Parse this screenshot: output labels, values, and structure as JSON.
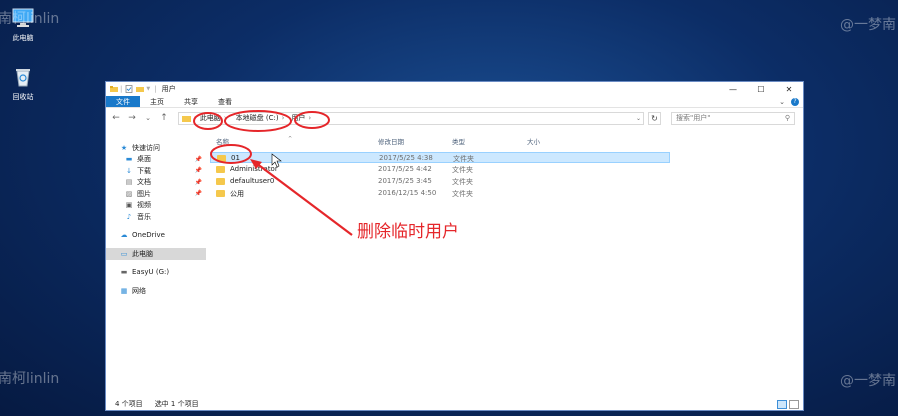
{
  "desktop": {
    "icons": [
      {
        "name": "this-pc-desktop-icon",
        "label": "此电脑"
      },
      {
        "name": "recycle-bin-desktop-icon",
        "label": "回收站"
      }
    ],
    "watermarks": [
      "南柯linlin",
      "@一梦南",
      "南柯linlin",
      "@一梦南"
    ]
  },
  "window": {
    "title": "用户",
    "qat_separator": "|",
    "qat_dropdown": "▼",
    "controls": {
      "minimize": "—",
      "maximize": "☐",
      "close": "✕"
    },
    "ribbon_tabs": [
      "文件",
      "主页",
      "共享",
      "查看"
    ],
    "ribbon_expand": "⌄",
    "help": "?",
    "nav": {
      "back": "←",
      "forward": "→",
      "recent": "⌄",
      "up": "↑"
    },
    "breadcrumb": [
      "此电脑",
      "本地磁盘 (C:)",
      "用户"
    ],
    "breadcrumb_sep": "›",
    "address_dropdown": "⌄",
    "refresh": "↻",
    "search": {
      "placeholder": "搜索\"用户\"",
      "icon": "⚲"
    }
  },
  "navpane": {
    "quick_access": {
      "label": "快速访问",
      "icon": "★"
    },
    "pinned": [
      {
        "label": "桌面",
        "icon": "▬"
      },
      {
        "label": "下载",
        "icon": "↓"
      },
      {
        "label": "文档",
        "icon": "▤"
      },
      {
        "label": "图片",
        "icon": "▨"
      }
    ],
    "pin_icon": "📌",
    "others": [
      {
        "label": "视频",
        "icon": "▣"
      },
      {
        "label": "音乐",
        "icon": "♪"
      }
    ],
    "onedrive": {
      "label": "OneDrive",
      "icon": "☁"
    },
    "this_pc": {
      "label": "此电脑",
      "icon": "▭"
    },
    "easyu": {
      "label": "EasyU (G:)",
      "icon": "▬"
    },
    "network": {
      "label": "网络",
      "icon": "▦"
    }
  },
  "columns": {
    "name": "名称",
    "date": "修改日期",
    "type": "类型",
    "size": "大小",
    "sort_caret": "^"
  },
  "files": [
    {
      "name": "01",
      "date": "2017/5/25 4:38",
      "type": "文件夹",
      "selected": true
    },
    {
      "name": "Administrator",
      "date": "2017/5/25 4:42",
      "type": "文件夹",
      "selected": false
    },
    {
      "name": "defaultuser0",
      "date": "2017/5/25 3:45",
      "type": "文件夹",
      "selected": false
    },
    {
      "name": "公用",
      "date": "2016/12/15 4:50",
      "type": "文件夹",
      "selected": false
    }
  ],
  "status": {
    "count": "4 个项目",
    "selected": "选中 1 个项目"
  },
  "annotation": {
    "text": "删除临时用户",
    "color": "#e5262a"
  },
  "colors": {
    "accent": "#1979ca",
    "selection": "#cce8ff",
    "folder": "#f5c84c"
  }
}
